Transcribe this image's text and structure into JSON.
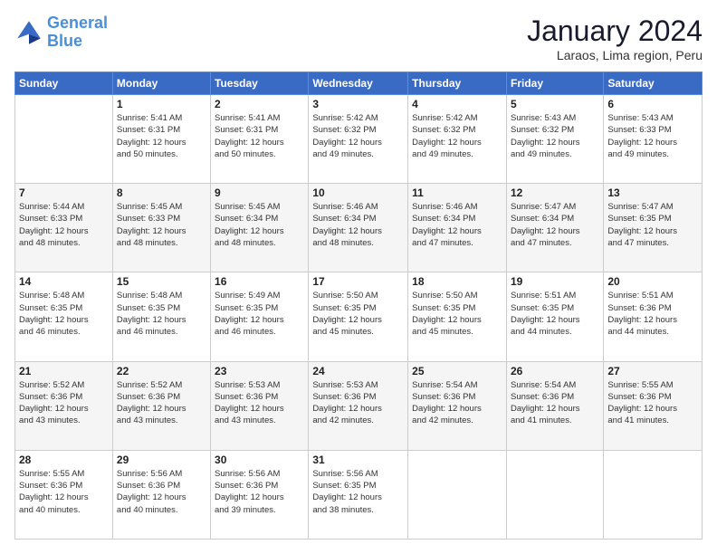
{
  "logo": {
    "line1": "General",
    "line2": "Blue"
  },
  "title": "January 2024",
  "subtitle": "Laraos, Lima region, Peru",
  "days_header": [
    "Sunday",
    "Monday",
    "Tuesday",
    "Wednesday",
    "Thursday",
    "Friday",
    "Saturday"
  ],
  "weeks": [
    [
      {
        "day": "",
        "info": ""
      },
      {
        "day": "1",
        "info": "Sunrise: 5:41 AM\nSunset: 6:31 PM\nDaylight: 12 hours\nand 50 minutes."
      },
      {
        "day": "2",
        "info": "Sunrise: 5:41 AM\nSunset: 6:31 PM\nDaylight: 12 hours\nand 50 minutes."
      },
      {
        "day": "3",
        "info": "Sunrise: 5:42 AM\nSunset: 6:32 PM\nDaylight: 12 hours\nand 49 minutes."
      },
      {
        "day": "4",
        "info": "Sunrise: 5:42 AM\nSunset: 6:32 PM\nDaylight: 12 hours\nand 49 minutes."
      },
      {
        "day": "5",
        "info": "Sunrise: 5:43 AM\nSunset: 6:32 PM\nDaylight: 12 hours\nand 49 minutes."
      },
      {
        "day": "6",
        "info": "Sunrise: 5:43 AM\nSunset: 6:33 PM\nDaylight: 12 hours\nand 49 minutes."
      }
    ],
    [
      {
        "day": "7",
        "info": "Sunrise: 5:44 AM\nSunset: 6:33 PM\nDaylight: 12 hours\nand 48 minutes."
      },
      {
        "day": "8",
        "info": "Sunrise: 5:45 AM\nSunset: 6:33 PM\nDaylight: 12 hours\nand 48 minutes."
      },
      {
        "day": "9",
        "info": "Sunrise: 5:45 AM\nSunset: 6:34 PM\nDaylight: 12 hours\nand 48 minutes."
      },
      {
        "day": "10",
        "info": "Sunrise: 5:46 AM\nSunset: 6:34 PM\nDaylight: 12 hours\nand 48 minutes."
      },
      {
        "day": "11",
        "info": "Sunrise: 5:46 AM\nSunset: 6:34 PM\nDaylight: 12 hours\nand 47 minutes."
      },
      {
        "day": "12",
        "info": "Sunrise: 5:47 AM\nSunset: 6:34 PM\nDaylight: 12 hours\nand 47 minutes."
      },
      {
        "day": "13",
        "info": "Sunrise: 5:47 AM\nSunset: 6:35 PM\nDaylight: 12 hours\nand 47 minutes."
      }
    ],
    [
      {
        "day": "14",
        "info": "Sunrise: 5:48 AM\nSunset: 6:35 PM\nDaylight: 12 hours\nand 46 minutes."
      },
      {
        "day": "15",
        "info": "Sunrise: 5:48 AM\nSunset: 6:35 PM\nDaylight: 12 hours\nand 46 minutes."
      },
      {
        "day": "16",
        "info": "Sunrise: 5:49 AM\nSunset: 6:35 PM\nDaylight: 12 hours\nand 46 minutes."
      },
      {
        "day": "17",
        "info": "Sunrise: 5:50 AM\nSunset: 6:35 PM\nDaylight: 12 hours\nand 45 minutes."
      },
      {
        "day": "18",
        "info": "Sunrise: 5:50 AM\nSunset: 6:35 PM\nDaylight: 12 hours\nand 45 minutes."
      },
      {
        "day": "19",
        "info": "Sunrise: 5:51 AM\nSunset: 6:35 PM\nDaylight: 12 hours\nand 44 minutes."
      },
      {
        "day": "20",
        "info": "Sunrise: 5:51 AM\nSunset: 6:36 PM\nDaylight: 12 hours\nand 44 minutes."
      }
    ],
    [
      {
        "day": "21",
        "info": "Sunrise: 5:52 AM\nSunset: 6:36 PM\nDaylight: 12 hours\nand 43 minutes."
      },
      {
        "day": "22",
        "info": "Sunrise: 5:52 AM\nSunset: 6:36 PM\nDaylight: 12 hours\nand 43 minutes."
      },
      {
        "day": "23",
        "info": "Sunrise: 5:53 AM\nSunset: 6:36 PM\nDaylight: 12 hours\nand 43 minutes."
      },
      {
        "day": "24",
        "info": "Sunrise: 5:53 AM\nSunset: 6:36 PM\nDaylight: 12 hours\nand 42 minutes."
      },
      {
        "day": "25",
        "info": "Sunrise: 5:54 AM\nSunset: 6:36 PM\nDaylight: 12 hours\nand 42 minutes."
      },
      {
        "day": "26",
        "info": "Sunrise: 5:54 AM\nSunset: 6:36 PM\nDaylight: 12 hours\nand 41 minutes."
      },
      {
        "day": "27",
        "info": "Sunrise: 5:55 AM\nSunset: 6:36 PM\nDaylight: 12 hours\nand 41 minutes."
      }
    ],
    [
      {
        "day": "28",
        "info": "Sunrise: 5:55 AM\nSunset: 6:36 PM\nDaylight: 12 hours\nand 40 minutes."
      },
      {
        "day": "29",
        "info": "Sunrise: 5:56 AM\nSunset: 6:36 PM\nDaylight: 12 hours\nand 40 minutes."
      },
      {
        "day": "30",
        "info": "Sunrise: 5:56 AM\nSunset: 6:36 PM\nDaylight: 12 hours\nand 39 minutes."
      },
      {
        "day": "31",
        "info": "Sunrise: 5:56 AM\nSunset: 6:35 PM\nDaylight: 12 hours\nand 38 minutes."
      },
      {
        "day": "",
        "info": ""
      },
      {
        "day": "",
        "info": ""
      },
      {
        "day": "",
        "info": ""
      }
    ]
  ]
}
